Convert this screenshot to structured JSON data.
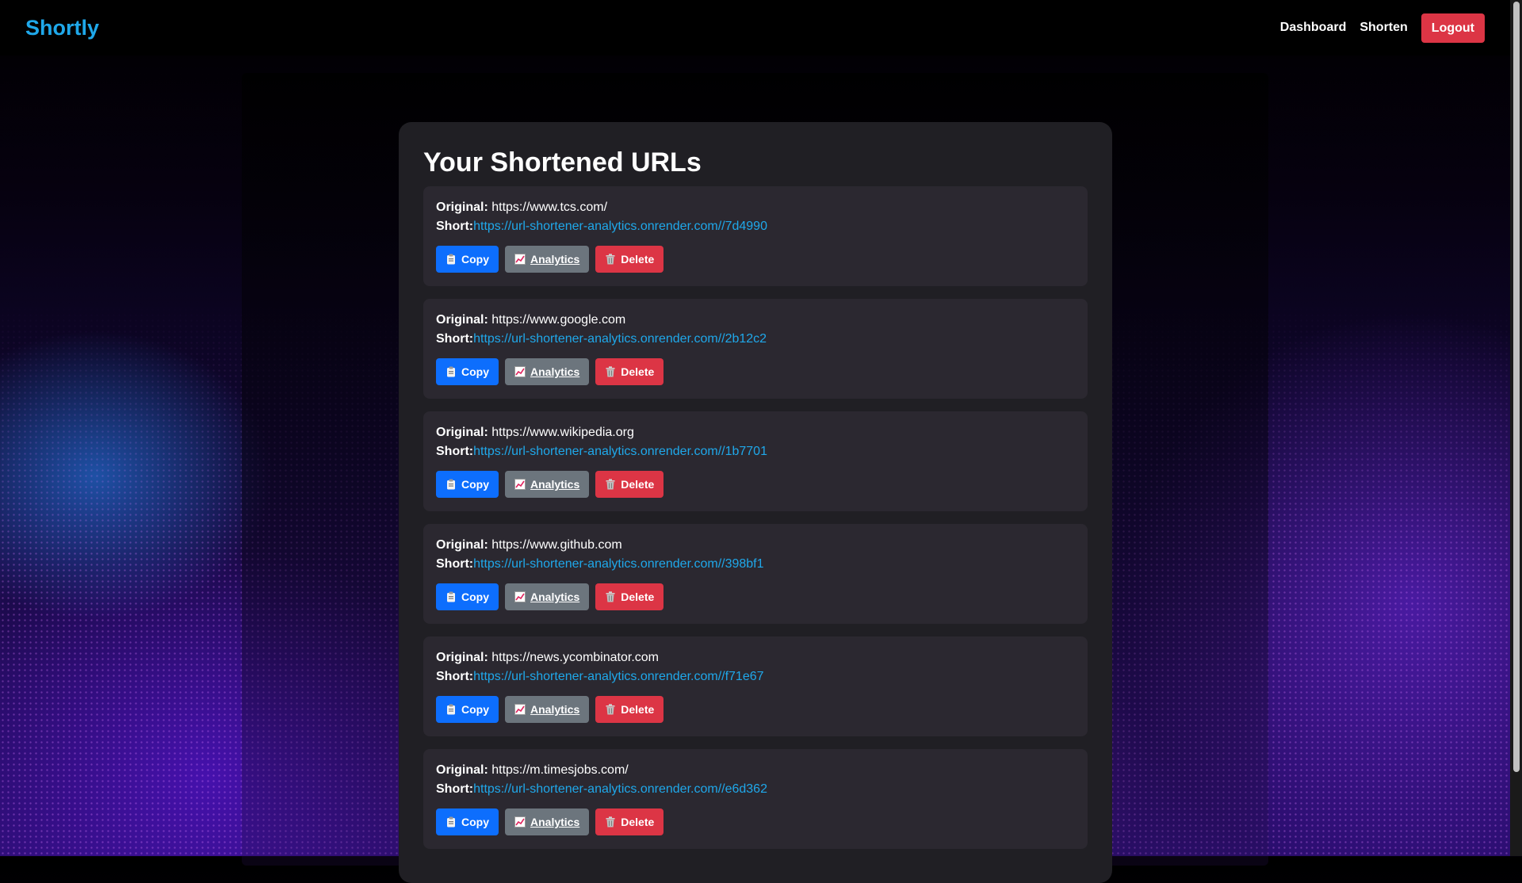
{
  "navbar": {
    "brand": "Shortly",
    "links": [
      {
        "label": "Dashboard"
      },
      {
        "label": "Shorten"
      }
    ],
    "logout_label": "Logout"
  },
  "main": {
    "title": "Your Shortened URLs",
    "original_label": "Original:",
    "short_label": "Short:",
    "buttons": {
      "copy": "Copy",
      "analytics": "Analytics",
      "delete": "Delete"
    },
    "urls": [
      {
        "original": "https://www.tcs.com/",
        "short": "https://url-shortener-analytics.onrender.com//7d4990"
      },
      {
        "original": "https://www.google.com",
        "short": "https://url-shortener-analytics.onrender.com//2b12c2"
      },
      {
        "original": "https://www.wikipedia.org",
        "short": "https://url-shortener-analytics.onrender.com//1b7701"
      },
      {
        "original": "https://www.github.com",
        "short": "https://url-shortener-analytics.onrender.com//398bf1"
      },
      {
        "original": "https://news.ycombinator.com",
        "short": "https://url-shortener-analytics.onrender.com//f71e67"
      },
      {
        "original": "https://m.timesjobs.com/",
        "short": "https://url-shortener-analytics.onrender.com//e6d362"
      }
    ]
  },
  "icons": {
    "copy": "clipboard-icon",
    "analytics": "chart-icon",
    "delete": "trash-icon"
  },
  "colors": {
    "brand": "#1fa8ea",
    "link": "#1fa8ea",
    "copy_button": "#0d6efd",
    "analytics_button": "#6c757d",
    "delete_button": "#dc3545",
    "card_bg": "#201f24",
    "item_bg": "#2b2830"
  }
}
